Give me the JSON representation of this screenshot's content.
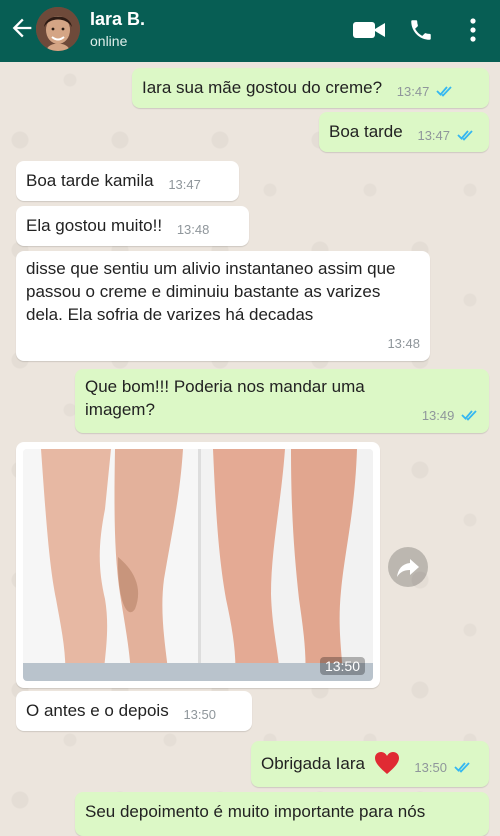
{
  "contact": {
    "name": "Iara B.",
    "status": "online"
  },
  "icons": {
    "back": "arrow-left-icon",
    "video": "video-call-icon",
    "call": "phone-icon",
    "menu": "more-vert-icon",
    "ticks": "double-check-read-icon",
    "share": "forward-icon",
    "heart": "red-heart-emoji"
  },
  "colors": {
    "header": "#075e54",
    "outgoing": "#dcf8c6",
    "incoming": "#ffffff",
    "ticks": "#34b7f1",
    "heart": "#e02a33"
  },
  "messages": [
    {
      "text": "Iara sua mãe gostou do creme?",
      "time": "13:47"
    },
    {
      "text": "Boa tarde",
      "time": "13:47"
    },
    {
      "text": "Boa tarde kamila",
      "time": "13:47"
    },
    {
      "text": "Ela gostou muito!!",
      "time": "13:48"
    },
    {
      "text": "disse que sentiu um alivio instantaneo assim que passou o creme e diminuiu bastante as varizes dela. Ela sofria de varizes há decadas",
      "time": "13:48"
    },
    {
      "text": "Que bom!!! Poderia nos mandar uma imagem?",
      "time": "13:49"
    },
    {
      "text": "",
      "time": "13:50"
    },
    {
      "text": "O antes e o depois",
      "time": "13:50"
    },
    {
      "text": "Obrigada Iara",
      "time": "13:50"
    },
    {
      "text": "Seu depoimento é muito importante para nós",
      "time": ""
    }
  ]
}
